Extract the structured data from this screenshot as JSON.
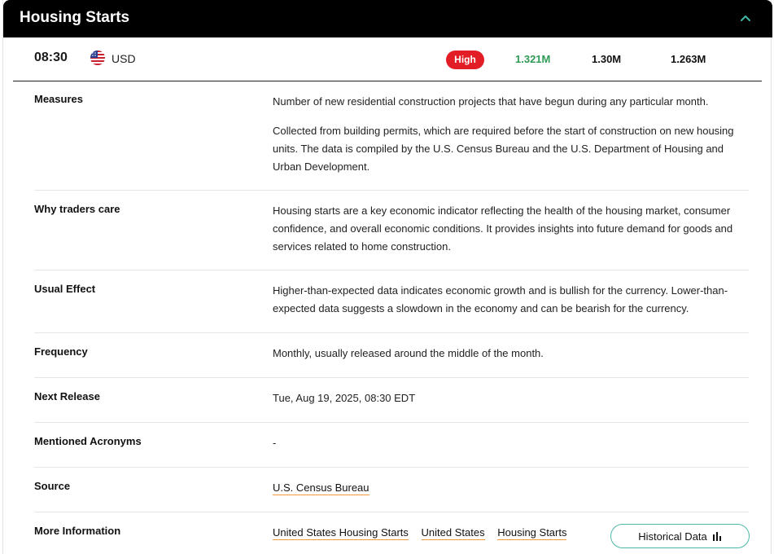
{
  "header": {
    "title": "Housing Starts",
    "collapse_icon": "chevron-up-icon"
  },
  "event": {
    "time": "08:30",
    "currency": "USD",
    "flag_icon": "us-flag-icon",
    "impact": "High",
    "actual": "1.321M",
    "forecast": "1.30M",
    "previous": "1.263M",
    "colors": {
      "impact": "#e21d25",
      "actual": "#2e9b56"
    }
  },
  "details": {
    "measures": {
      "label": "Measures",
      "p1": "Number of new residential construction projects that have begun during any particular month.",
      "p2": "Collected from building permits, which are required before the start of construction on new housing units. The data is compiled by the U.S. Census Bureau and the U.S. Department of Housing and Urban Development."
    },
    "why": {
      "label": "Why traders care",
      "text": "Housing starts are a key economic indicator reflecting the health of the housing market, consumer confidence, and overall economic conditions. It provides insights into future demand for goods and services related to home construction."
    },
    "effect": {
      "label": "Usual Effect",
      "text": "Higher-than-expected data indicates economic growth and is bullish for the currency. Lower-than-expected data suggests a slowdown in the economy and can be bearish for the currency."
    },
    "frequency": {
      "label": "Frequency",
      "text": "Monthly, usually released around the middle of the month."
    },
    "next_release": {
      "label": "Next Release",
      "text": "Tue, Aug 19, 2025, 08:30 EDT"
    },
    "acronyms": {
      "label": "Mentioned Acronyms",
      "text": "-"
    },
    "source": {
      "label": "Source",
      "link": "U.S. Census Bureau"
    },
    "more_info": {
      "label": "More Information",
      "links": [
        "United States Housing Starts",
        "United States",
        "Housing Starts"
      ],
      "historical_button": "Historical Data",
      "historical_icon": "bar-chart-icon"
    }
  }
}
